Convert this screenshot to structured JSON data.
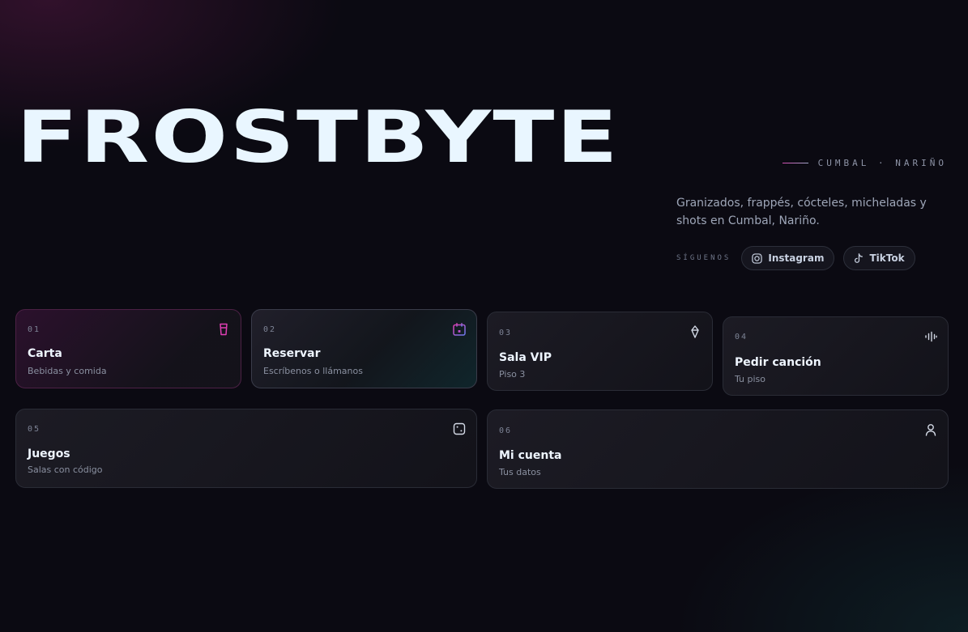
{
  "brand": {
    "name": "FROSTBYTE"
  },
  "location": "CUMBAL · NARIÑO",
  "tagline": "Granizados, frappés, cócteles, micheladas y shots en Cumbal, Nariño.",
  "social": {
    "label": "SÍGUENOS",
    "instagram": {
      "label": "Instagram",
      "icon": "instagram-icon"
    },
    "tiktok": {
      "label": "TikTok",
      "icon": "tiktok-icon"
    }
  },
  "colors": {
    "background": "#0b0a12",
    "accent_pink": "#e03fb4",
    "accent_cyan": "#2aa7a8",
    "text": "#e9f6ff"
  },
  "cards": [
    {
      "num": "01",
      "title": "Carta",
      "subtitle": "Bebidas y comida",
      "icon": "drink-cup-icon"
    },
    {
      "num": "02",
      "title": "Reservar",
      "subtitle": "Escríbenos o llámanos",
      "icon": "calendar-icon"
    },
    {
      "num": "03",
      "title": "Sala VIP",
      "subtitle": "Piso 3",
      "icon": "diamond-icon"
    },
    {
      "num": "04",
      "title": "Pedir canción",
      "subtitle": "Tu piso",
      "icon": "audio-wave-icon"
    },
    {
      "num": "05",
      "title": "Juegos",
      "subtitle": "Salas con código",
      "icon": "dice-icon"
    },
    {
      "num": "06",
      "title": "Mi cuenta",
      "subtitle": "Tus datos",
      "icon": "user-icon"
    }
  ]
}
